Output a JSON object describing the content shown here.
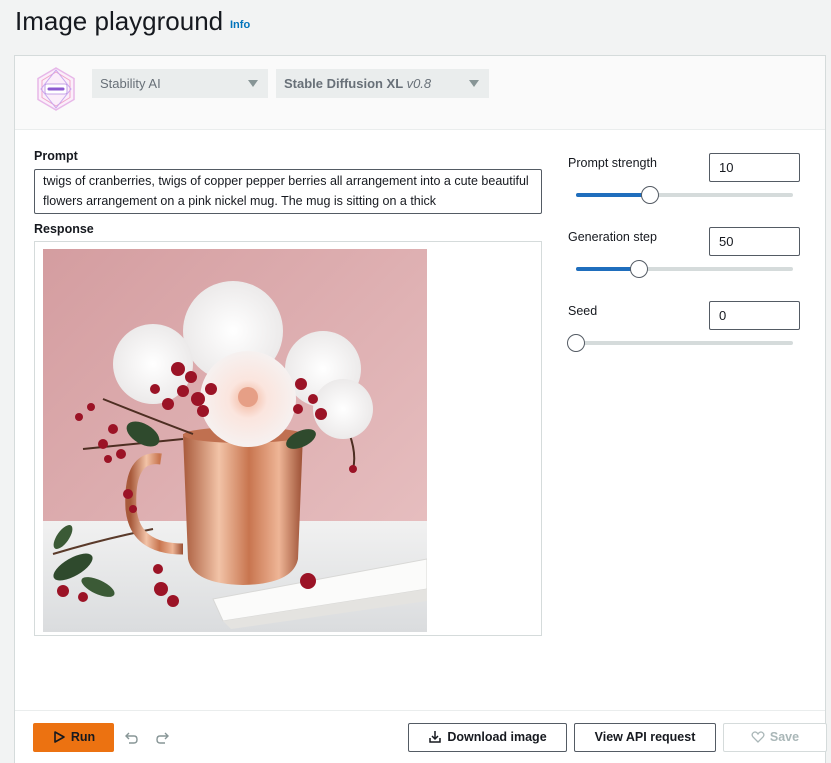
{
  "header": {
    "title": "Image playground",
    "info_label": "Info"
  },
  "model_selector": {
    "provider": "Stability AI",
    "model_name": "Stable Diffusion XL",
    "model_version": "v0.8",
    "logo_icon": "stability-ai-logo"
  },
  "prompt": {
    "label": "Prompt",
    "value": "twigs of cranberries, twigs of copper pepper berries all arrangement into a cute beautiful flowers arrangement on a pink nickel mug. The mug is sitting on a thick"
  },
  "response": {
    "label": "Response",
    "image_alt": "Generated image: white and pink flowers with red berries in a copper mug on a pink background"
  },
  "parameters": {
    "prompt_strength": {
      "label": "Prompt strength",
      "value": "10",
      "slider_fraction": 0.34
    },
    "generation_step": {
      "label": "Generation step",
      "value": "50",
      "slider_fraction": 0.29
    },
    "seed": {
      "label": "Seed",
      "value": "0",
      "slider_fraction": 0.0
    }
  },
  "footer": {
    "run_label": "Run",
    "download_label": "Download image",
    "api_label": "View API request",
    "save_label": "Save"
  },
  "colors": {
    "primary_button": "#ec7211",
    "slider_fill": "#1f6ebd",
    "link": "#0073bb"
  }
}
